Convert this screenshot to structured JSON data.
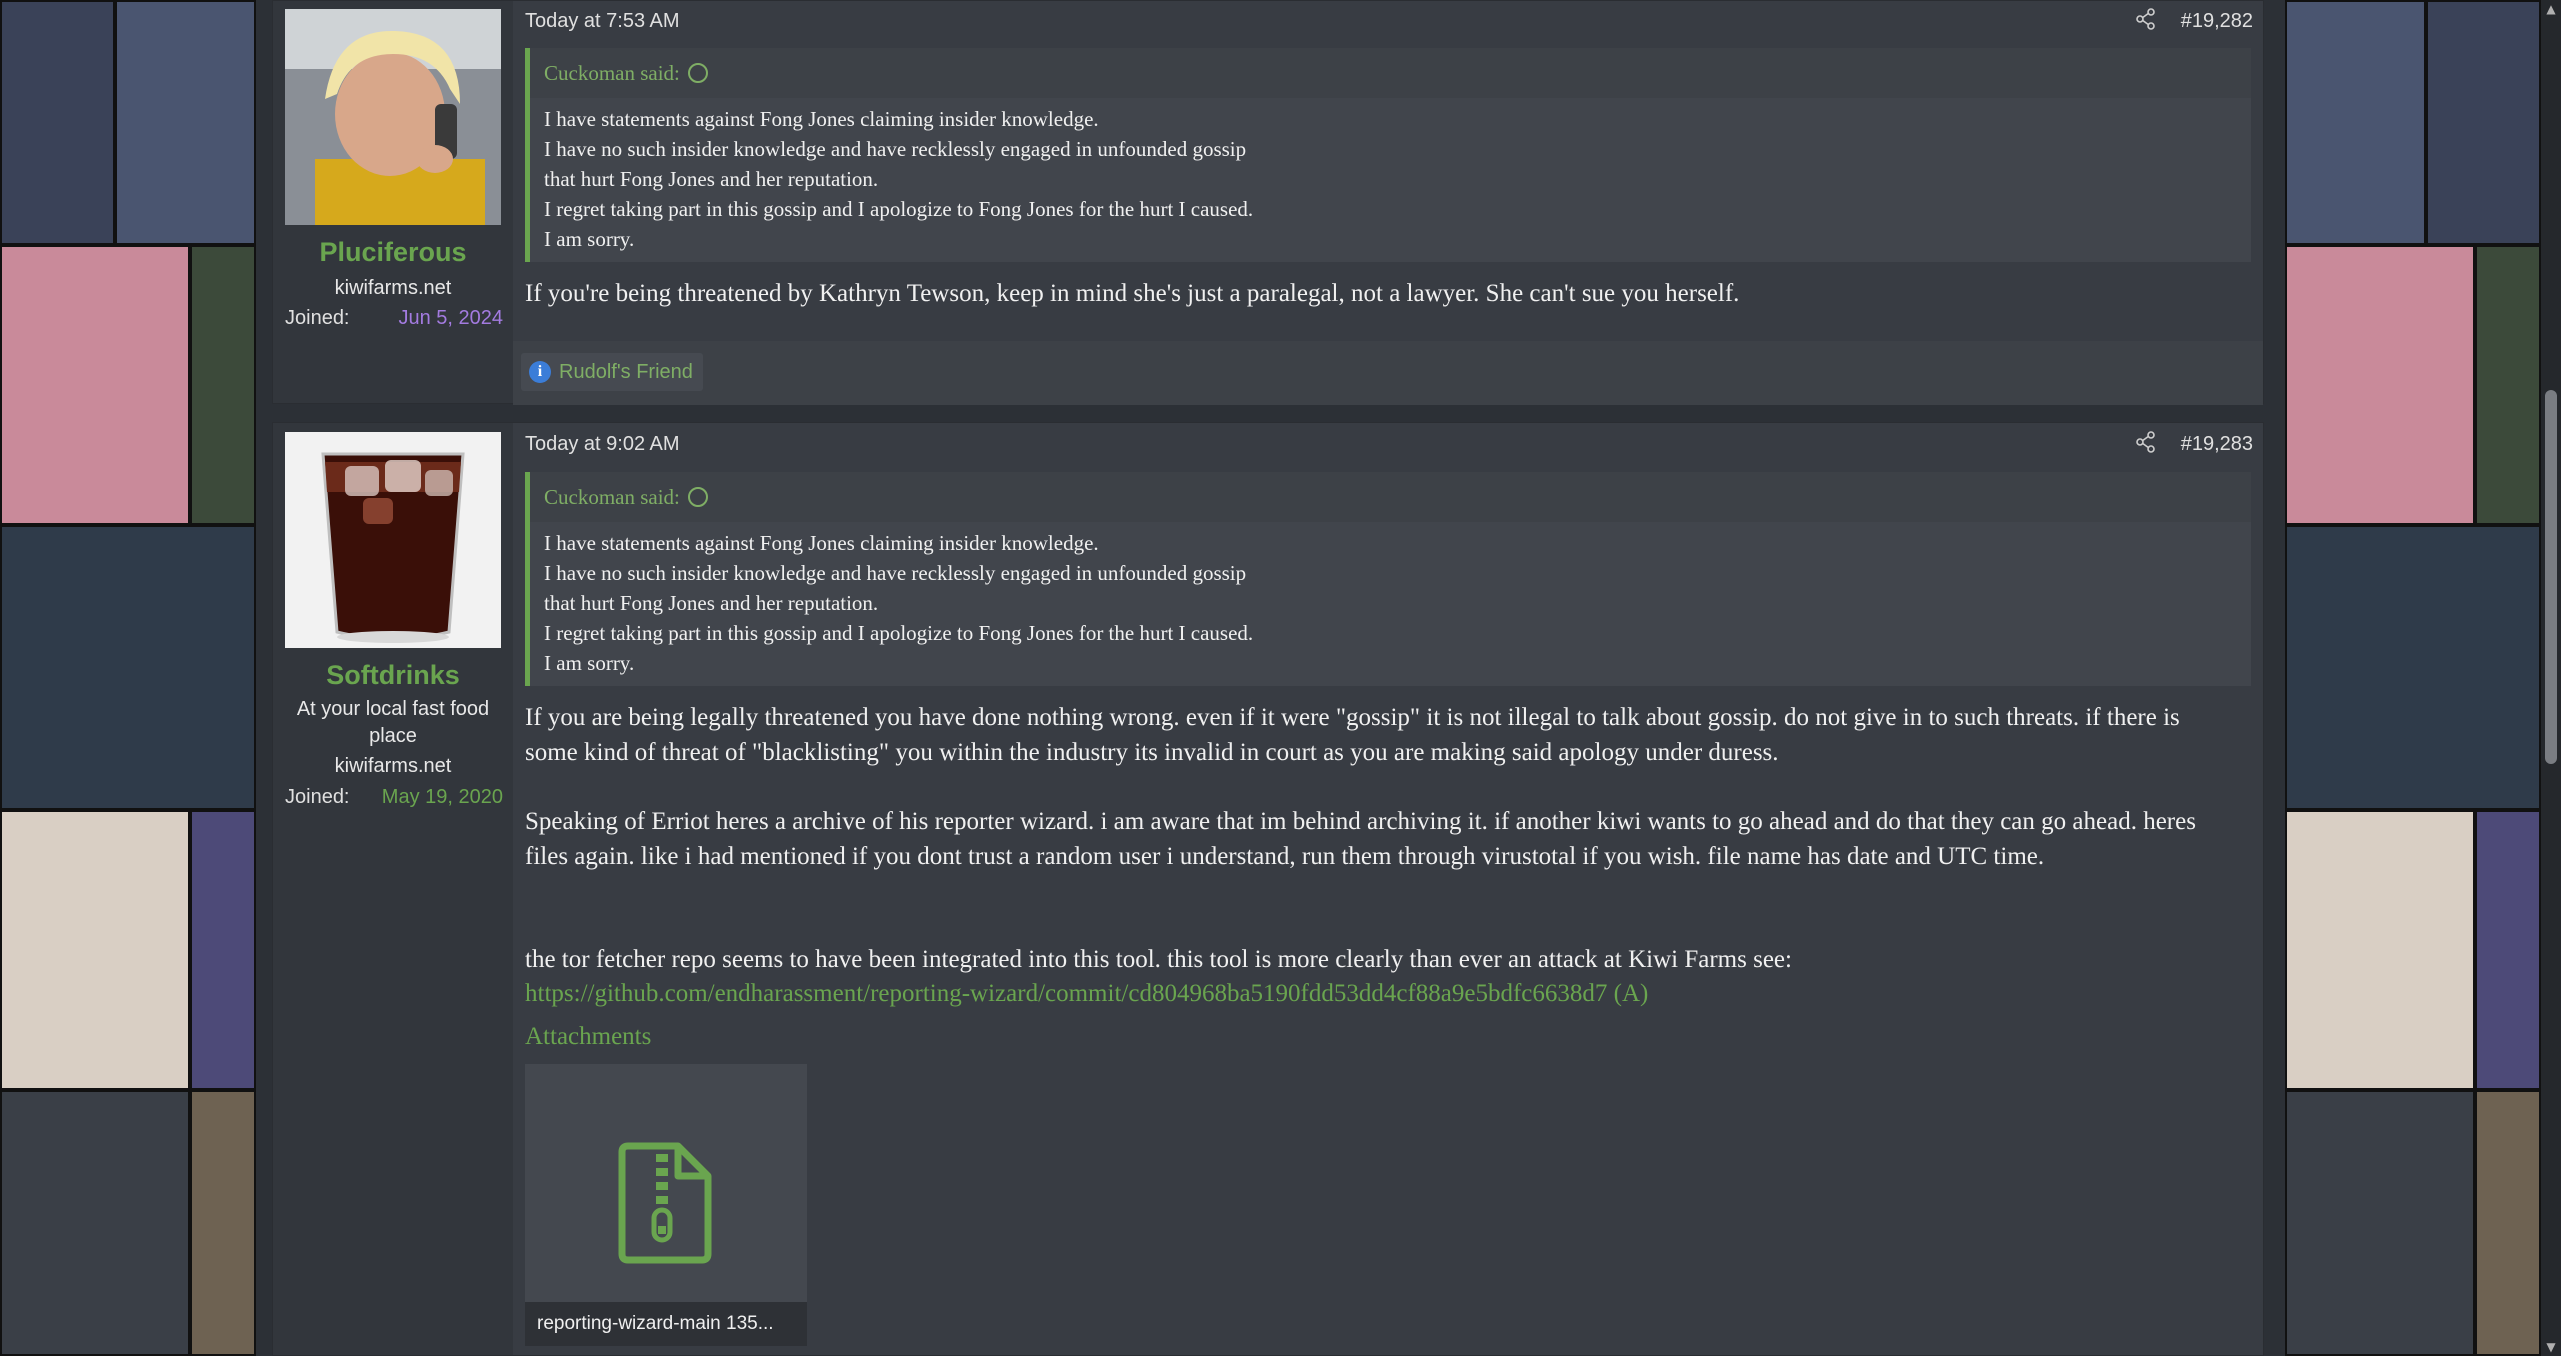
{
  "posts": [
    {
      "username": "Pluciferous",
      "site": "kiwifarms.net",
      "joined_label": "Joined:",
      "joined_value": "Jun 5, 2024",
      "timestamp": "Today at 7:53 AM",
      "post_number": "#19,282",
      "quote_author": "Cuckoman said:",
      "quote_lines": [
        "I have statements against Fong Jones claiming insider knowledge.",
        "I have no such insider knowledge and have recklessly engaged in unfounded gossip",
        "that hurt Fong Jones and her reputation.",
        "I regret taking part in this gossip and I apologize to Fong Jones for the hurt I caused.",
        "I am sorry."
      ],
      "body": "If you're being threatened by Kathryn Tewson, keep in mind she's just a paralegal, not a lawyer. She can't sue you herself.",
      "reaction": "Rudolf's Friend"
    },
    {
      "username": "Softdrinks",
      "user_title_1": "At your local fast food",
      "user_title_2": "place",
      "site": "kiwifarms.net",
      "joined_label": "Joined:",
      "joined_value": "May 19, 2020",
      "timestamp": "Today at 9:02 AM",
      "post_number": "#19,283",
      "quote_author": "Cuckoman said:",
      "quote_lines": [
        "I have statements against Fong Jones claiming insider knowledge.",
        "I have no such insider knowledge and have recklessly engaged in unfounded gossip",
        "that hurt Fong Jones and her reputation.",
        "I regret taking part in this gossip and I apologize to Fong Jones for the hurt I caused.",
        "I am sorry."
      ],
      "paragraph_1": "If you are being legally threatened you have done nothing wrong. even if it were \"gossip\" it is not illegal to talk about gossip. do not give in to such threats. if there is some kind of threat of \"blacklisting\" you within the industry its invalid in court as you are making said apology under duress.",
      "paragraph_2": "Speaking of Erriot heres a archive of his reporter wizard. i am aware that im behind archiving it. if another kiwi wants to go ahead and do that they can go ahead. heres files again. like i had mentioned if you dont trust a random user i understand, run them through virustotal if you wish. file name has date and UTC time.",
      "paragraph_3": "the tor fetcher repo seems to have been integrated into this tool. this tool is more clearly than ever an attack at Kiwi Farms see:",
      "link": "https://github.com/endharassment/reporting-wizard/commit/cd804968ba5190fdd53dd4cf88a9e5bdfc6638d7 (A)",
      "attachments_label": "Attachments",
      "attachment_name": "reporting-wizard-main 135..."
    }
  ],
  "colors": {
    "accent_green": "#6aa54f",
    "joined_purple": "#a37be0",
    "post_bg": "#383c43"
  },
  "icons": [
    "share-icon",
    "up-arrow-circle-icon",
    "info-icon",
    "zip-file-icon"
  ]
}
